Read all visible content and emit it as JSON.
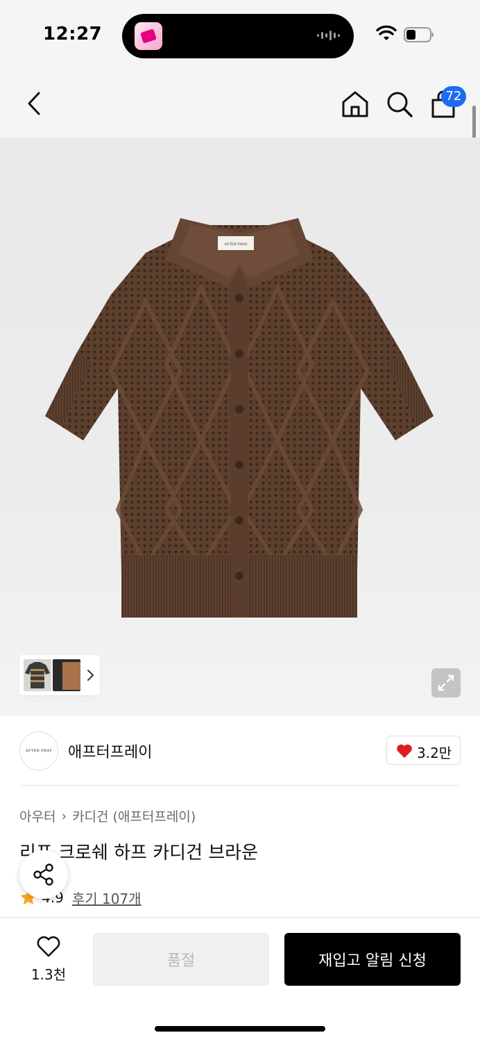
{
  "status_bar": {
    "time": "12:27",
    "icons": [
      "app-icon",
      "audio-wave-icon",
      "wifi-icon",
      "battery-icon"
    ]
  },
  "nav": {
    "icons": [
      "back-icon",
      "home-icon",
      "search-icon",
      "cart-icon"
    ],
    "cart_count": "72"
  },
  "hero": {
    "image": "brown crochet short-sleeve cardigan",
    "collar_tag_text": "AFTER PRAY",
    "thumbnails": [
      "striped-cardigan-thumbnail",
      "brown-cardigan-thumbnail"
    ],
    "icons": [
      "chevron-right-icon",
      "expand-icon"
    ]
  },
  "brand": {
    "logo_text": "AFTER PRAY",
    "name": "애프터프레이",
    "like_count": "3.2만",
    "like_icon": "heart-filled-icon",
    "accent_color": "#e01b24"
  },
  "product": {
    "breadcrumb": [
      "아우터",
      "카디건 (애프터프레이)"
    ],
    "breadcrumb_separator": "›",
    "title": "리프 크로쉐 하프 카디건 브라운",
    "rating": "4.9",
    "review_label": "후기 107개",
    "star_color": "#f5a623"
  },
  "bottom_bar": {
    "wish_count": "1.3천",
    "soldout_label": "품절",
    "restock_label": "재입고 알림 신청"
  },
  "colors": {
    "badge": "#1c6bf5",
    "primary_button": "#000000",
    "disabled_button": "#f1f1f1"
  }
}
